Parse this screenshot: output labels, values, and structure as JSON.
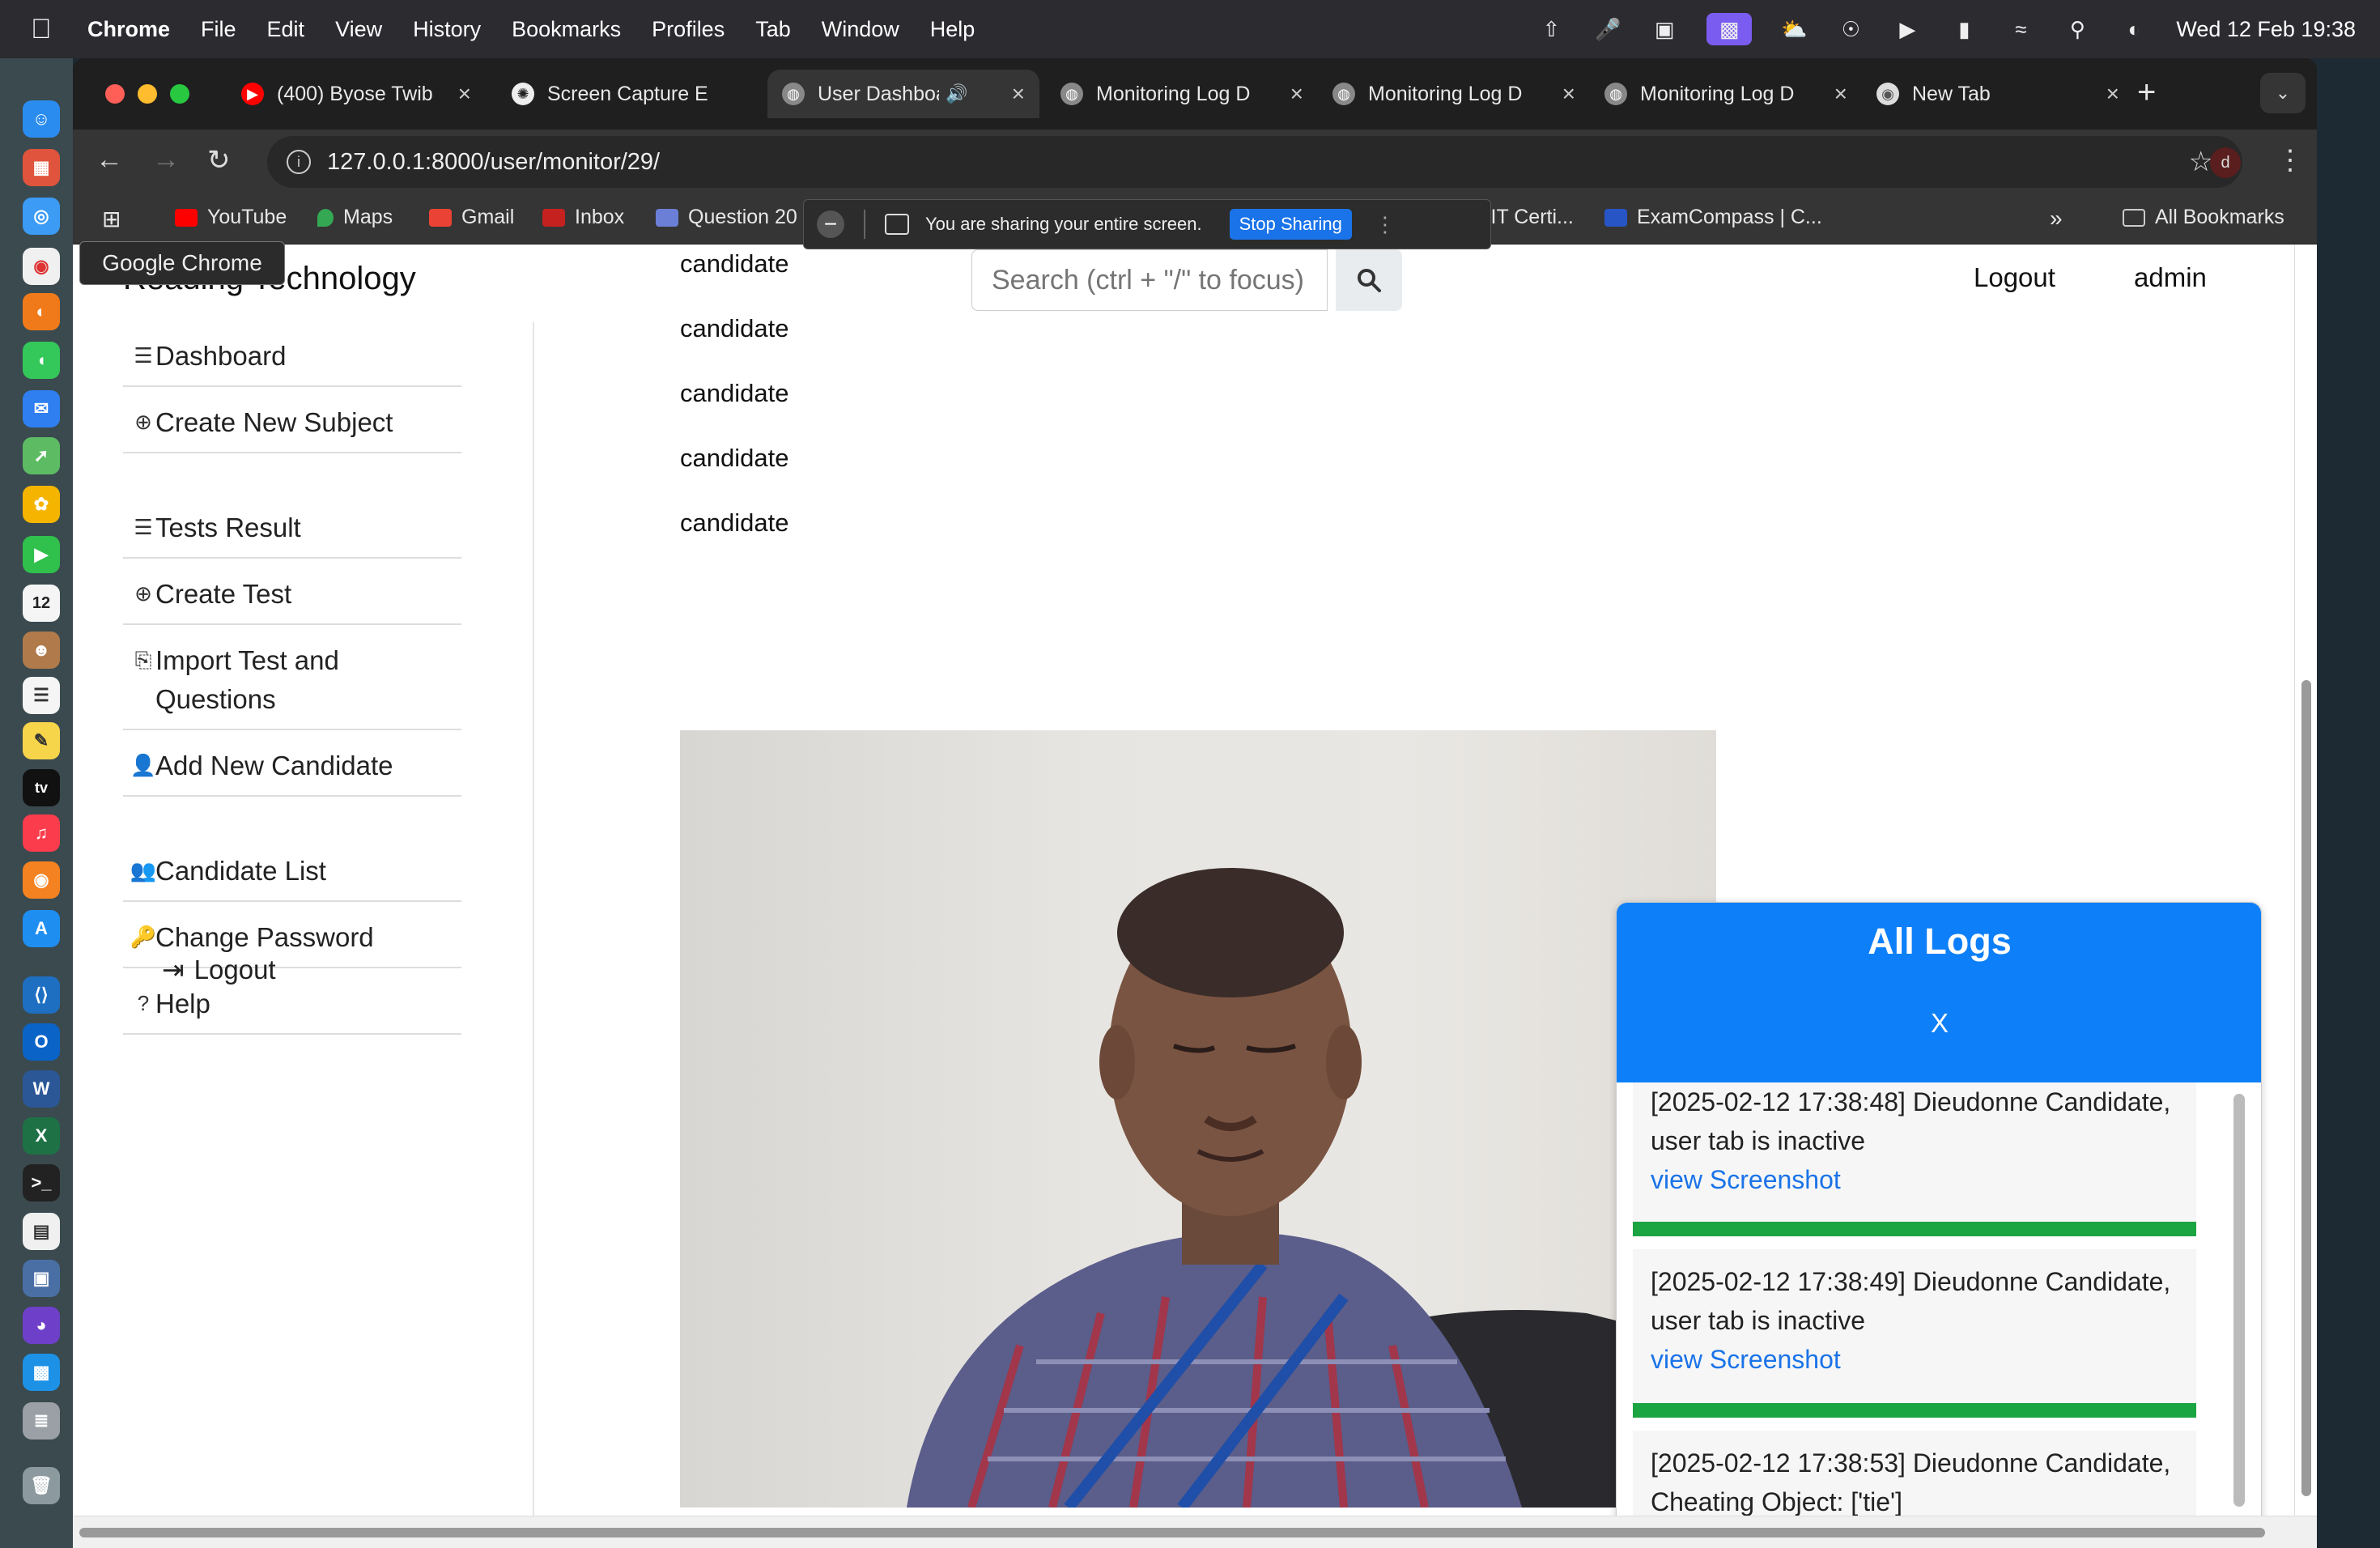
{
  "menubar": {
    "app": "Chrome",
    "items": [
      "File",
      "Edit",
      "View",
      "History",
      "Bookmarks",
      "Profiles",
      "Tab",
      "Window",
      "Help"
    ],
    "datetime": "Wed 12 Feb  19:38"
  },
  "tabs": [
    {
      "title": "(400) Byose Twib",
      "icon": "youtube-icon"
    },
    {
      "title": "Screen Capture E",
      "icon": "openai-icon"
    },
    {
      "title": "User Dashboa",
      "icon": "globe-icon",
      "active": true
    },
    {
      "title": "Monitoring Log D",
      "icon": "globe-icon"
    },
    {
      "title": "Monitoring Log D",
      "icon": "globe-icon"
    },
    {
      "title": "Monitoring Log D",
      "icon": "globe-icon"
    },
    {
      "title": "New Tab",
      "icon": "chrome-icon"
    }
  ],
  "toolbar": {
    "url": "127.0.0.1:8000/user/monitor/29/",
    "profile_initial": "d"
  },
  "bookmarks": {
    "items": [
      "YouTube",
      "Maps",
      "Gmail",
      "Inbox",
      "Question 20",
      "% Real IT Certi...",
      "ExamCompass | C..."
    ],
    "all_bookmarks": "All Bookmarks"
  },
  "sharing": {
    "message": "You are sharing your entire screen.",
    "stop_label": "Stop Sharing"
  },
  "tooltip": "Google Chrome",
  "site": {
    "brand": "Reading Technology",
    "search_placeholder": "Search (ctrl + \"/\" to focus)",
    "nav_logout": "Logout",
    "nav_user": "admin"
  },
  "sidebar": {
    "items": [
      {
        "label": "Dashboard",
        "icon": "list-icon"
      },
      {
        "label": "Create New Subject",
        "icon": "plus-circle-icon"
      },
      {
        "label": "Tests Result",
        "icon": "list-icon"
      },
      {
        "label": "Create Test",
        "icon": "plus-circle-icon"
      },
      {
        "label": "Import Test and Questions",
        "icon": "file-import-icon"
      },
      {
        "label": "Add New Candidate",
        "icon": "user-plus-icon"
      },
      {
        "label": "Candidate List",
        "icon": "users-icon"
      },
      {
        "label": "Change Password",
        "icon": "key-icon"
      },
      {
        "label": "Help",
        "icon": "question-circle-icon"
      }
    ],
    "logout": "Logout"
  },
  "main": {
    "candidate_labels": [
      "candidate",
      "candidate",
      "candidate",
      "candidate",
      "candidate"
    ],
    "candidate_bottom": "candidate"
  },
  "logs": {
    "title": "All Logs",
    "close": "X",
    "entries": [
      {
        "text": "[2025-02-12 17:38:48] Dieudonne Candidate, user tab is inactive",
        "link": "view Screenshot"
      },
      {
        "text": "[2025-02-12 17:38:49] Dieudonne Candidate, user tab is inactive",
        "link": "view Screenshot"
      },
      {
        "text": "[2025-02-12 17:38:53] Dieudonne Candidate, Cheating Object: ['tie']",
        "link": ""
      }
    ]
  },
  "colors": {
    "logs_header": "#0d7ff8",
    "log_border": "#1aa442",
    "link": "#1a73e8",
    "stop_sharing": "#1a73e8"
  }
}
